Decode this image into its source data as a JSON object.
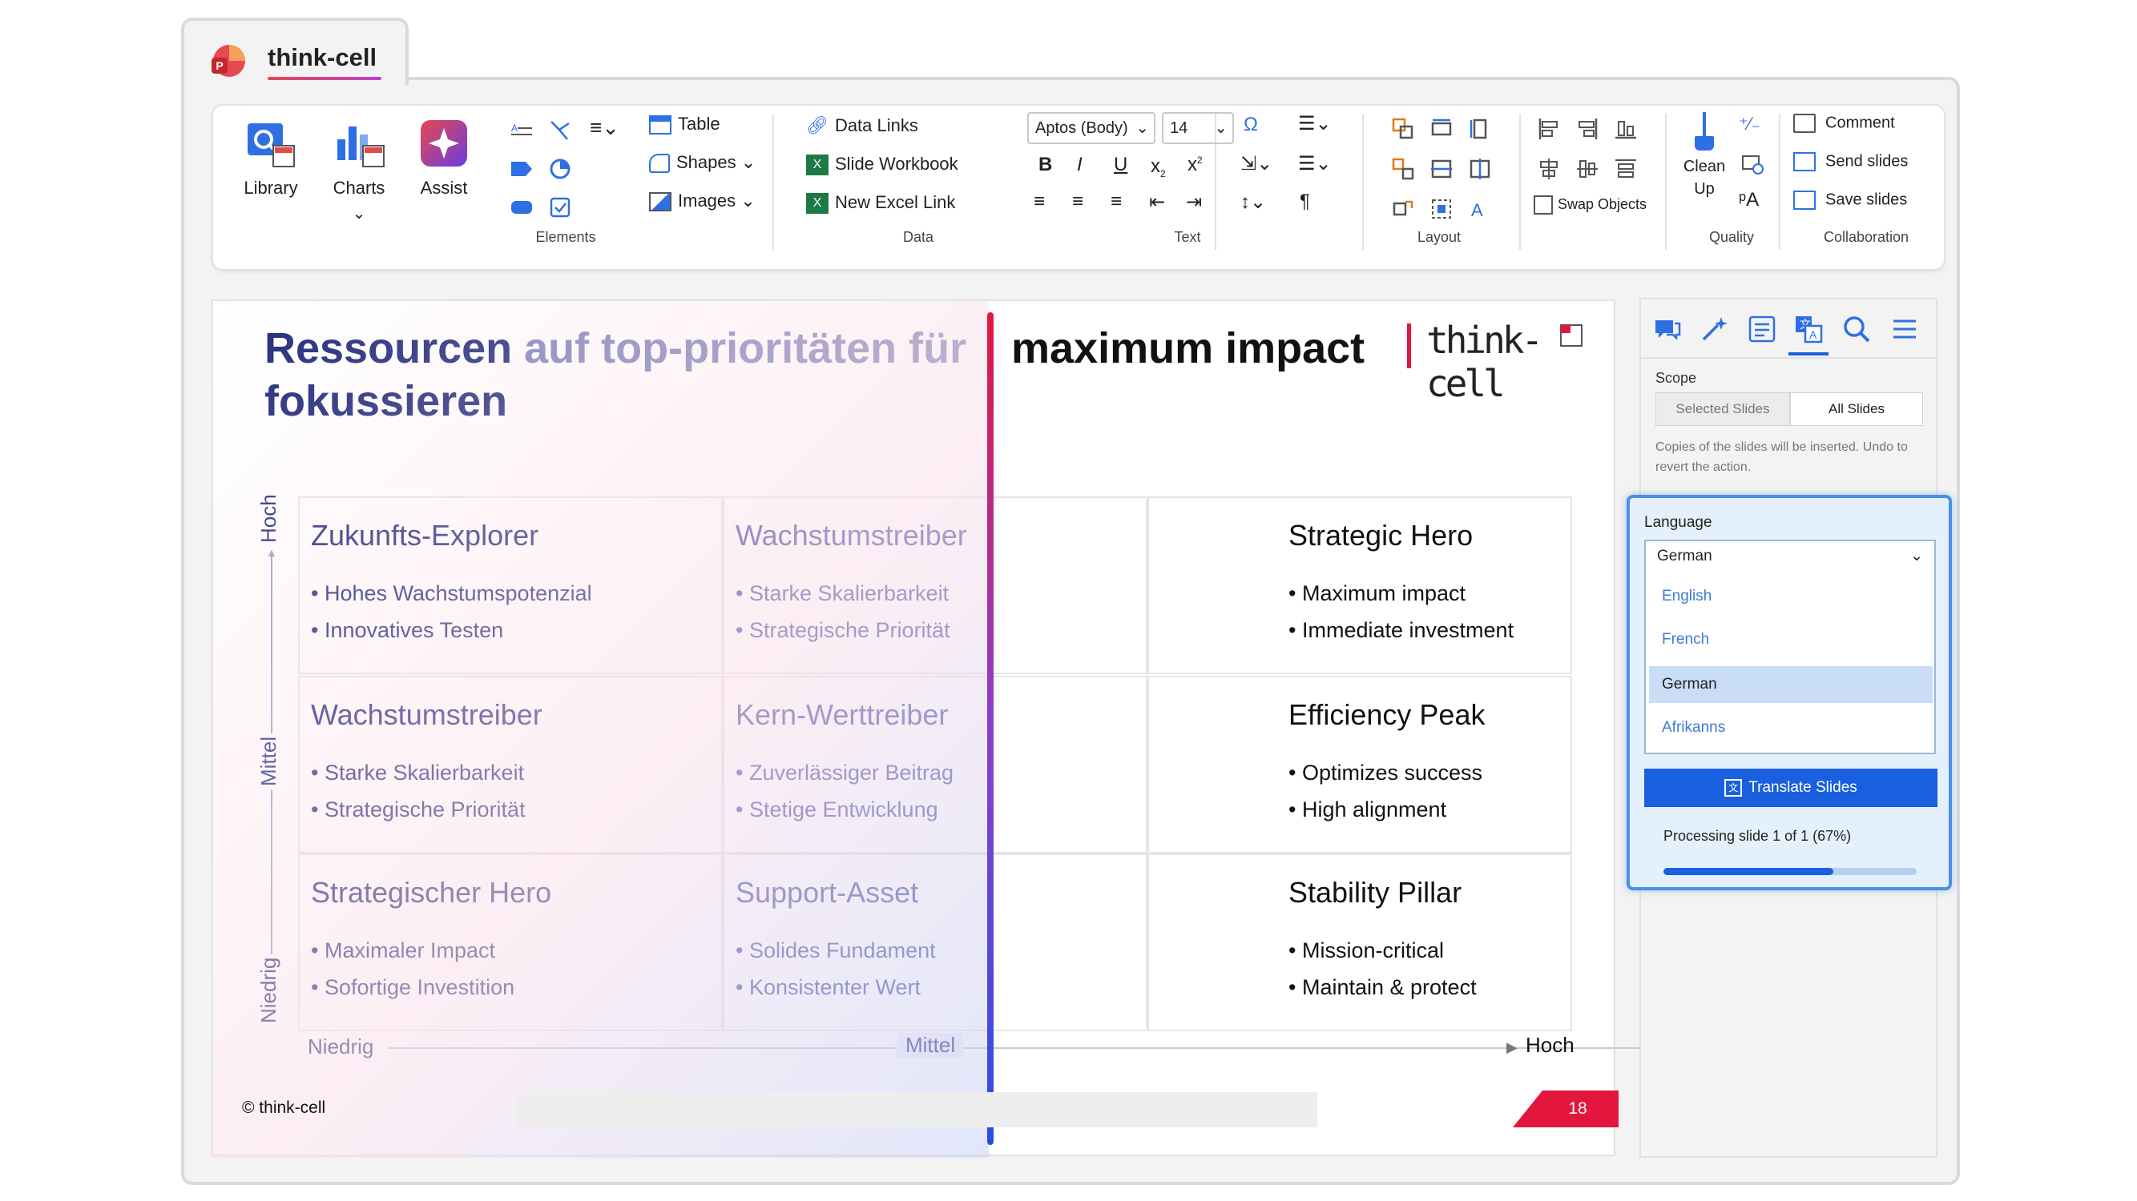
{
  "app": {
    "tab_title": "think-cell"
  },
  "ribbon": {
    "library": "Library",
    "charts": "Charts",
    "assist": "Assist",
    "table": "Table",
    "shapes": "Shapes",
    "images": "Images",
    "elements_group": "Elements",
    "data_links": "Data Links",
    "slide_workbook": "Slide Workbook",
    "new_excel_link": "New Excel Link",
    "data_group": "Data",
    "font_name": "Aptos (Body)",
    "font_size": "14",
    "text_group": "Text",
    "layout_group": "Layout",
    "swap_objects": "Swap Objects",
    "clean_up_1": "Clean",
    "clean_up_2": "Up",
    "quality_group": "Quality",
    "comment": "Comment",
    "send_slides": "Send slides",
    "save_slides": "Save slides",
    "collab_group": "Collaboration",
    "format": {
      "bold": "B",
      "italic": "I",
      "underline": "U",
      "subscript": "x",
      "superscript": "x"
    }
  },
  "slide": {
    "title_part1": "Ressourcen ",
    "title_part2": "auf top-prioritäten für",
    "title_line2": "fokussieren",
    "title_right": "maximum impact",
    "brand": "think-cell",
    "y_axis": {
      "high": "Hoch",
      "mid": "Mittel",
      "low": "Niedrig"
    },
    "x_axis": {
      "low": "Niedrig",
      "mid": "Mittel",
      "high": "Hoch"
    },
    "cells": [
      {
        "title": "Zukunfts-Explorer",
        "bullets": [
          "Hohes Wachstumspotenzial",
          "Innovatives Testen"
        ]
      },
      {
        "title": "Wachstumstreiber",
        "bullets": [
          "Starke Skalierbarkeit",
          "Strategische Priorität"
        ]
      },
      {
        "title": "Strategic Hero",
        "bullets": [
          "Maximum impact",
          "Immediate investment"
        ]
      },
      {
        "title": "Wachstumstreiber",
        "bullets": [
          "Starke Skalierbarkeit",
          "Strategische Priorität"
        ]
      },
      {
        "title": "Kern-Werttreiber",
        "bullets": [
          "Zuverlässiger Beitrag",
          "Stetige Entwicklung"
        ]
      },
      {
        "title": "Efficiency Peak",
        "bullets": [
          "Optimizes success",
          "High alignment"
        ]
      },
      {
        "title": "Strategischer Hero",
        "bullets": [
          "Maximaler Impact",
          "Sofortige Investition"
        ]
      },
      {
        "title": "Support-Asset",
        "bullets": [
          "Solides Fundament",
          "Konsistenter Wert"
        ]
      },
      {
        "title": "Stability Pillar",
        "bullets": [
          "Mission-critical",
          "Maintain & protect"
        ]
      }
    ],
    "footer": "© think-cell",
    "page_number": "18"
  },
  "pane": {
    "scope_label": "Scope",
    "selected_slides": "Selected Slides",
    "all_slides": "All Slides",
    "help_text": "Copies of the slides will be inserted. Undo to revert the action.",
    "language_label": "Language",
    "language_value": "German",
    "options": [
      "English",
      "French",
      "German",
      "Afrikanns"
    ],
    "translate_button": "Translate Slides",
    "processing": "Processing slide 1 of 1 (67%)",
    "progress_fraction": 0.67
  },
  "colors": {
    "accent": "#1a5fe0",
    "brand_red": "#e3173e",
    "title_blue": "#1f2a7a"
  }
}
